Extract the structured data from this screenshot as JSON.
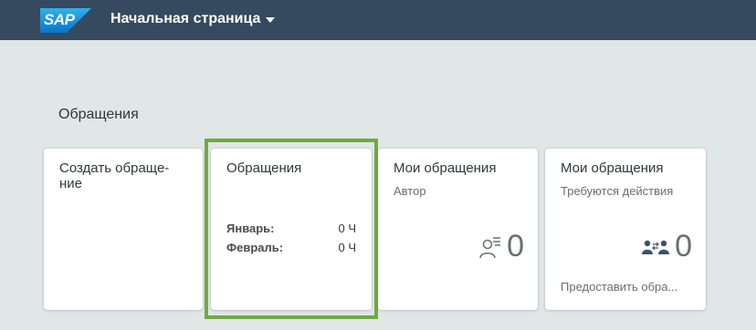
{
  "shell": {
    "logo_text": "SAP",
    "app_title": "Начальная страница"
  },
  "group": {
    "title": "Обращения"
  },
  "tiles": [
    {
      "title": "Создать обраще-\nние"
    },
    {
      "title": "Обращения",
      "rows": [
        {
          "key": "Январь:",
          "value": "0 Ч"
        },
        {
          "key": "Февраль:",
          "value": "0 Ч"
        }
      ]
    },
    {
      "title": "Мои обращения",
      "subtitle": "Автор",
      "kpi": "0",
      "icon": "user-list-icon"
    },
    {
      "title": "Мои обращения",
      "subtitle": "Требуются действия",
      "kpi": "0",
      "icon": "user-exchange-icon",
      "footer": "Предоставить обра..."
    }
  ],
  "colors": {
    "shell": "#354a5f",
    "highlight": "#6fab3e",
    "logo": "#1a9ce0"
  }
}
